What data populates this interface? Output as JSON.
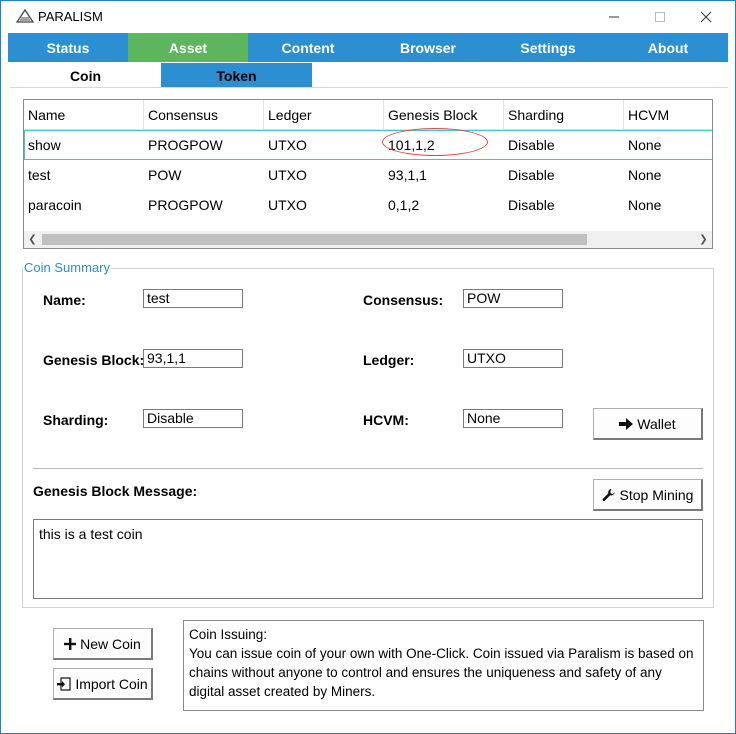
{
  "window": {
    "title": "PARALISM"
  },
  "main_tabs": [
    {
      "label": "Status"
    },
    {
      "label": "Asset"
    },
    {
      "label": "Content"
    },
    {
      "label": "Browser"
    },
    {
      "label": "Settings"
    },
    {
      "label": "About"
    }
  ],
  "sub_tabs": {
    "coin": "Coin",
    "token": "Token"
  },
  "table": {
    "headers": [
      "Name",
      "Consensus",
      "Ledger",
      "Genesis Block",
      "Sharding",
      "HCVM"
    ],
    "rows": [
      [
        "show",
        "PROGPOW",
        "UTXO",
        "101,1,2",
        "Disable",
        "None"
      ],
      [
        "test",
        "POW",
        "UTXO",
        "93,1,1",
        "Disable",
        "None"
      ],
      [
        "paracoin",
        "PROGPOW",
        "UTXO",
        "0,1,2",
        "Disable",
        "None"
      ]
    ]
  },
  "summary": {
    "title": "Coin Summary",
    "name_label": "Name:",
    "name_value": "test",
    "consensus_label": "Consensus:",
    "consensus_value": "POW",
    "genesis_label": "Genesis Block:",
    "genesis_value": "93,1,1",
    "ledger_label": "Ledger:",
    "ledger_value": "UTXO",
    "sharding_label": "Sharding:",
    "sharding_value": "Disable",
    "hcvm_label": "HCVM:",
    "hcvm_value": "None",
    "wallet_button": "Wallet",
    "message_label": "Genesis Block Message:",
    "stop_mining_button": "Stop Mining",
    "message_text": "this is a test coin"
  },
  "actions": {
    "new_coin": "New Coin",
    "import_coin": "Import Coin"
  },
  "issuing": {
    "title": "Coin Issuing:",
    "text": "You can issue coin of your own with One-Click. Coin issued via Paralism is based on chains without anyone to control and ensures the uniqueness and safety of any digital asset created by Miners."
  },
  "colors": {
    "tab_bar": "#2b8fd1",
    "tab_active": "#5db55e",
    "selection_outline": "#46c4c4",
    "annotation_ellipse": "#e04848"
  }
}
